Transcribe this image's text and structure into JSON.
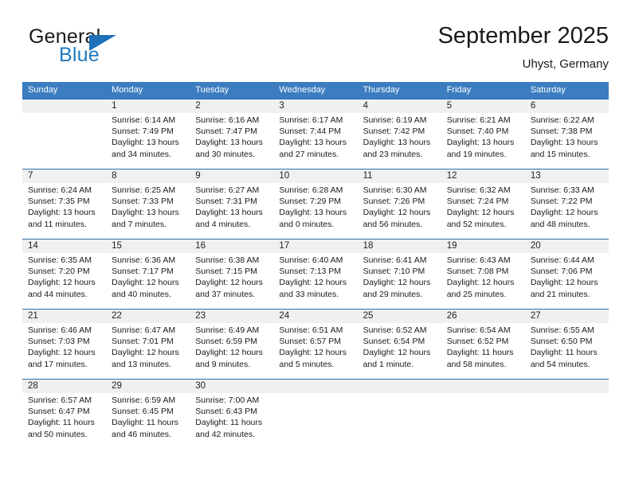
{
  "brand": {
    "name_top": "General",
    "name_bottom": "Blue",
    "triangle_color": "#1e70b8",
    "text_color": "#1e7ac0"
  },
  "header": {
    "title": "September 2025",
    "subtitle": "Uhyst, Germany"
  },
  "colors": {
    "header_bar": "#3b7dc0",
    "row_divider": "#2f6fae",
    "daynum_band": "#f0f0f0"
  },
  "weekdays": [
    "Sunday",
    "Monday",
    "Tuesday",
    "Wednesday",
    "Thursday",
    "Friday",
    "Saturday"
  ],
  "weeks": [
    [
      {
        "day": "",
        "sunrise": "",
        "sunset": "",
        "daylight_line1": "",
        "daylight_line2": ""
      },
      {
        "day": "1",
        "sunrise": "Sunrise: 6:14 AM",
        "sunset": "Sunset: 7:49 PM",
        "daylight_line1": "Daylight: 13 hours",
        "daylight_line2": "and 34 minutes."
      },
      {
        "day": "2",
        "sunrise": "Sunrise: 6:16 AM",
        "sunset": "Sunset: 7:47 PM",
        "daylight_line1": "Daylight: 13 hours",
        "daylight_line2": "and 30 minutes."
      },
      {
        "day": "3",
        "sunrise": "Sunrise: 6:17 AM",
        "sunset": "Sunset: 7:44 PM",
        "daylight_line1": "Daylight: 13 hours",
        "daylight_line2": "and 27 minutes."
      },
      {
        "day": "4",
        "sunrise": "Sunrise: 6:19 AM",
        "sunset": "Sunset: 7:42 PM",
        "daylight_line1": "Daylight: 13 hours",
        "daylight_line2": "and 23 minutes."
      },
      {
        "day": "5",
        "sunrise": "Sunrise: 6:21 AM",
        "sunset": "Sunset: 7:40 PM",
        "daylight_line1": "Daylight: 13 hours",
        "daylight_line2": "and 19 minutes."
      },
      {
        "day": "6",
        "sunrise": "Sunrise: 6:22 AM",
        "sunset": "Sunset: 7:38 PM",
        "daylight_line1": "Daylight: 13 hours",
        "daylight_line2": "and 15 minutes."
      }
    ],
    [
      {
        "day": "7",
        "sunrise": "Sunrise: 6:24 AM",
        "sunset": "Sunset: 7:35 PM",
        "daylight_line1": "Daylight: 13 hours",
        "daylight_line2": "and 11 minutes."
      },
      {
        "day": "8",
        "sunrise": "Sunrise: 6:25 AM",
        "sunset": "Sunset: 7:33 PM",
        "daylight_line1": "Daylight: 13 hours",
        "daylight_line2": "and 7 minutes."
      },
      {
        "day": "9",
        "sunrise": "Sunrise: 6:27 AM",
        "sunset": "Sunset: 7:31 PM",
        "daylight_line1": "Daylight: 13 hours",
        "daylight_line2": "and 4 minutes."
      },
      {
        "day": "10",
        "sunrise": "Sunrise: 6:28 AM",
        "sunset": "Sunset: 7:29 PM",
        "daylight_line1": "Daylight: 13 hours",
        "daylight_line2": "and 0 minutes."
      },
      {
        "day": "11",
        "sunrise": "Sunrise: 6:30 AM",
        "sunset": "Sunset: 7:26 PM",
        "daylight_line1": "Daylight: 12 hours",
        "daylight_line2": "and 56 minutes."
      },
      {
        "day": "12",
        "sunrise": "Sunrise: 6:32 AM",
        "sunset": "Sunset: 7:24 PM",
        "daylight_line1": "Daylight: 12 hours",
        "daylight_line2": "and 52 minutes."
      },
      {
        "day": "13",
        "sunrise": "Sunrise: 6:33 AM",
        "sunset": "Sunset: 7:22 PM",
        "daylight_line1": "Daylight: 12 hours",
        "daylight_line2": "and 48 minutes."
      }
    ],
    [
      {
        "day": "14",
        "sunrise": "Sunrise: 6:35 AM",
        "sunset": "Sunset: 7:20 PM",
        "daylight_line1": "Daylight: 12 hours",
        "daylight_line2": "and 44 minutes."
      },
      {
        "day": "15",
        "sunrise": "Sunrise: 6:36 AM",
        "sunset": "Sunset: 7:17 PM",
        "daylight_line1": "Daylight: 12 hours",
        "daylight_line2": "and 40 minutes."
      },
      {
        "day": "16",
        "sunrise": "Sunrise: 6:38 AM",
        "sunset": "Sunset: 7:15 PM",
        "daylight_line1": "Daylight: 12 hours",
        "daylight_line2": "and 37 minutes."
      },
      {
        "day": "17",
        "sunrise": "Sunrise: 6:40 AM",
        "sunset": "Sunset: 7:13 PM",
        "daylight_line1": "Daylight: 12 hours",
        "daylight_line2": "and 33 minutes."
      },
      {
        "day": "18",
        "sunrise": "Sunrise: 6:41 AM",
        "sunset": "Sunset: 7:10 PM",
        "daylight_line1": "Daylight: 12 hours",
        "daylight_line2": "and 29 minutes."
      },
      {
        "day": "19",
        "sunrise": "Sunrise: 6:43 AM",
        "sunset": "Sunset: 7:08 PM",
        "daylight_line1": "Daylight: 12 hours",
        "daylight_line2": "and 25 minutes."
      },
      {
        "day": "20",
        "sunrise": "Sunrise: 6:44 AM",
        "sunset": "Sunset: 7:06 PM",
        "daylight_line1": "Daylight: 12 hours",
        "daylight_line2": "and 21 minutes."
      }
    ],
    [
      {
        "day": "21",
        "sunrise": "Sunrise: 6:46 AM",
        "sunset": "Sunset: 7:03 PM",
        "daylight_line1": "Daylight: 12 hours",
        "daylight_line2": "and 17 minutes."
      },
      {
        "day": "22",
        "sunrise": "Sunrise: 6:47 AM",
        "sunset": "Sunset: 7:01 PM",
        "daylight_line1": "Daylight: 12 hours",
        "daylight_line2": "and 13 minutes."
      },
      {
        "day": "23",
        "sunrise": "Sunrise: 6:49 AM",
        "sunset": "Sunset: 6:59 PM",
        "daylight_line1": "Daylight: 12 hours",
        "daylight_line2": "and 9 minutes."
      },
      {
        "day": "24",
        "sunrise": "Sunrise: 6:51 AM",
        "sunset": "Sunset: 6:57 PM",
        "daylight_line1": "Daylight: 12 hours",
        "daylight_line2": "and 5 minutes."
      },
      {
        "day": "25",
        "sunrise": "Sunrise: 6:52 AM",
        "sunset": "Sunset: 6:54 PM",
        "daylight_line1": "Daylight: 12 hours",
        "daylight_line2": "and 1 minute."
      },
      {
        "day": "26",
        "sunrise": "Sunrise: 6:54 AM",
        "sunset": "Sunset: 6:52 PM",
        "daylight_line1": "Daylight: 11 hours",
        "daylight_line2": "and 58 minutes."
      },
      {
        "day": "27",
        "sunrise": "Sunrise: 6:55 AM",
        "sunset": "Sunset: 6:50 PM",
        "daylight_line1": "Daylight: 11 hours",
        "daylight_line2": "and 54 minutes."
      }
    ],
    [
      {
        "day": "28",
        "sunrise": "Sunrise: 6:57 AM",
        "sunset": "Sunset: 6:47 PM",
        "daylight_line1": "Daylight: 11 hours",
        "daylight_line2": "and 50 minutes."
      },
      {
        "day": "29",
        "sunrise": "Sunrise: 6:59 AM",
        "sunset": "Sunset: 6:45 PM",
        "daylight_line1": "Daylight: 11 hours",
        "daylight_line2": "and 46 minutes."
      },
      {
        "day": "30",
        "sunrise": "Sunrise: 7:00 AM",
        "sunset": "Sunset: 6:43 PM",
        "daylight_line1": "Daylight: 11 hours",
        "daylight_line2": "and 42 minutes."
      },
      {
        "day": "",
        "sunrise": "",
        "sunset": "",
        "daylight_line1": "",
        "daylight_line2": ""
      },
      {
        "day": "",
        "sunrise": "",
        "sunset": "",
        "daylight_line1": "",
        "daylight_line2": ""
      },
      {
        "day": "",
        "sunrise": "",
        "sunset": "",
        "daylight_line1": "",
        "daylight_line2": ""
      },
      {
        "day": "",
        "sunrise": "",
        "sunset": "",
        "daylight_line1": "",
        "daylight_line2": ""
      }
    ]
  ]
}
